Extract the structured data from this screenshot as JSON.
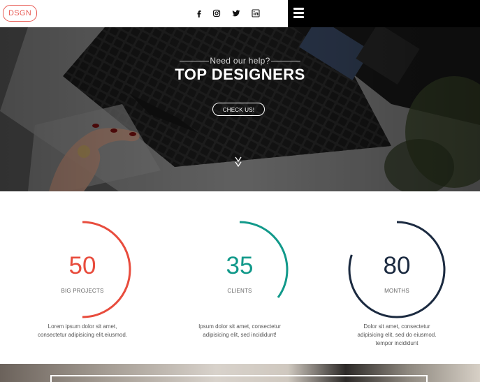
{
  "header": {
    "logo_text": "DSGN",
    "social_icons": [
      "facebook-icon",
      "instagram-icon",
      "twitter-icon",
      "linkedin-icon"
    ],
    "menu_icon": "hamburger-menu-icon"
  },
  "hero": {
    "subtitle": "Need our help?",
    "title": "TOP DESIGNERS",
    "button_label": "CHECK US!",
    "scroll_icon": "double-chevron-down-icon"
  },
  "stats": [
    {
      "value": "50",
      "label": "BIG PROJECTS",
      "description_line1": "Lorem ipsum dolor sit amet,",
      "description_line2": "consectetur adipisicing elit.eiusmod.",
      "description_line3": "",
      "color": "#e84c3d",
      "progress": 0.5
    },
    {
      "value": "35",
      "label": "CLIENTS",
      "description_line1": "Ipsum dolor sit amet, consectetur",
      "description_line2": "adipisicing elit, sed incididunt!",
      "description_line3": "",
      "color": "#11998a",
      "progress": 0.35
    },
    {
      "value": "80",
      "label": "MONTHS",
      "description_line1": "Dolor sit amet, consectetur",
      "description_line2": "adipisicing elit, sed do eiusmod.",
      "description_line3": "tempor incididunt",
      "color": "#1b2a40",
      "progress": 0.8
    }
  ]
}
